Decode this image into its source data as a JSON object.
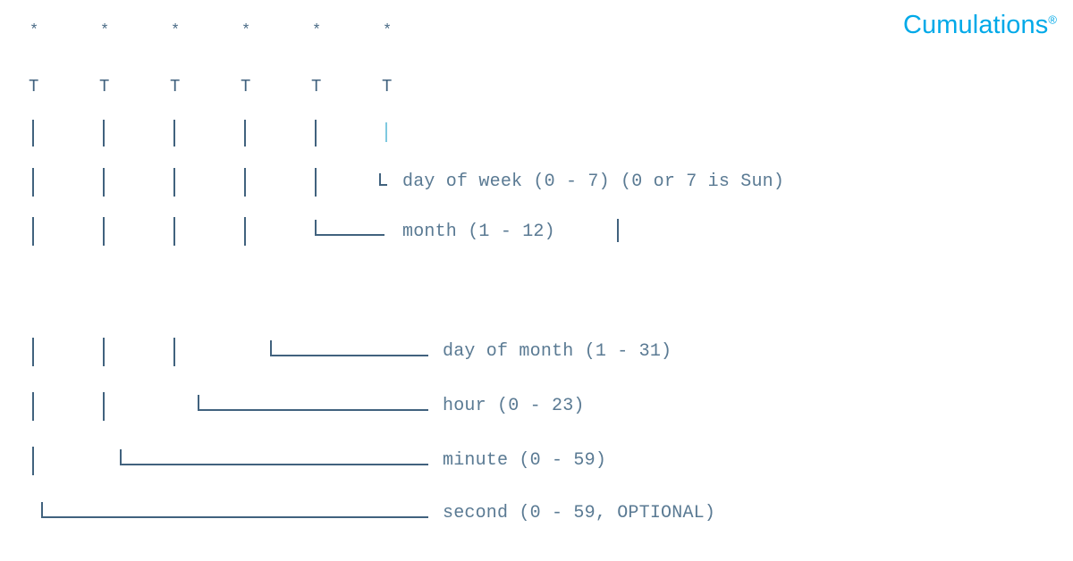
{
  "brand": {
    "name": "Cumulations",
    "registered_mark": "®",
    "color": "#00a9e8"
  },
  "diagram": {
    "type": "cron-expression-syntax",
    "field_marker": "*",
    "field_count": 6,
    "marker_row": [
      "*",
      "*",
      "*",
      "*",
      "*",
      "*"
    ],
    "tee_row": [
      "T",
      "T",
      "T",
      "T",
      "T",
      "T"
    ],
    "pipe_char": "|",
    "corner_char": "└",
    "text_color": "#5a7a93",
    "line_color": "#41627e",
    "fields": [
      {
        "index": 0,
        "name": "second",
        "label": "second (0 - 59, OPTIONAL)",
        "range_min": 0,
        "range_max": 59,
        "optional": true
      },
      {
        "index": 1,
        "name": "minute",
        "label": "minute (0 - 59)",
        "range_min": 0,
        "range_max": 59,
        "optional": false
      },
      {
        "index": 2,
        "name": "hour",
        "label": "hour (0 - 23)",
        "range_min": 0,
        "range_max": 23,
        "optional": false
      },
      {
        "index": 3,
        "name": "day of month",
        "label": "day of month (1 - 31)",
        "range_min": 1,
        "range_max": 31,
        "optional": false
      },
      {
        "index": 4,
        "name": "month",
        "label": "month (1 - 12)",
        "range_min": 1,
        "range_max": 12,
        "optional": false
      },
      {
        "index": 5,
        "name": "day of week",
        "label": "day of week (0 - 7) (0 or 7 is Sun)",
        "range_min": 0,
        "range_max": 7,
        "optional": false,
        "note": "(0 or 7 is Sun)"
      }
    ]
  }
}
